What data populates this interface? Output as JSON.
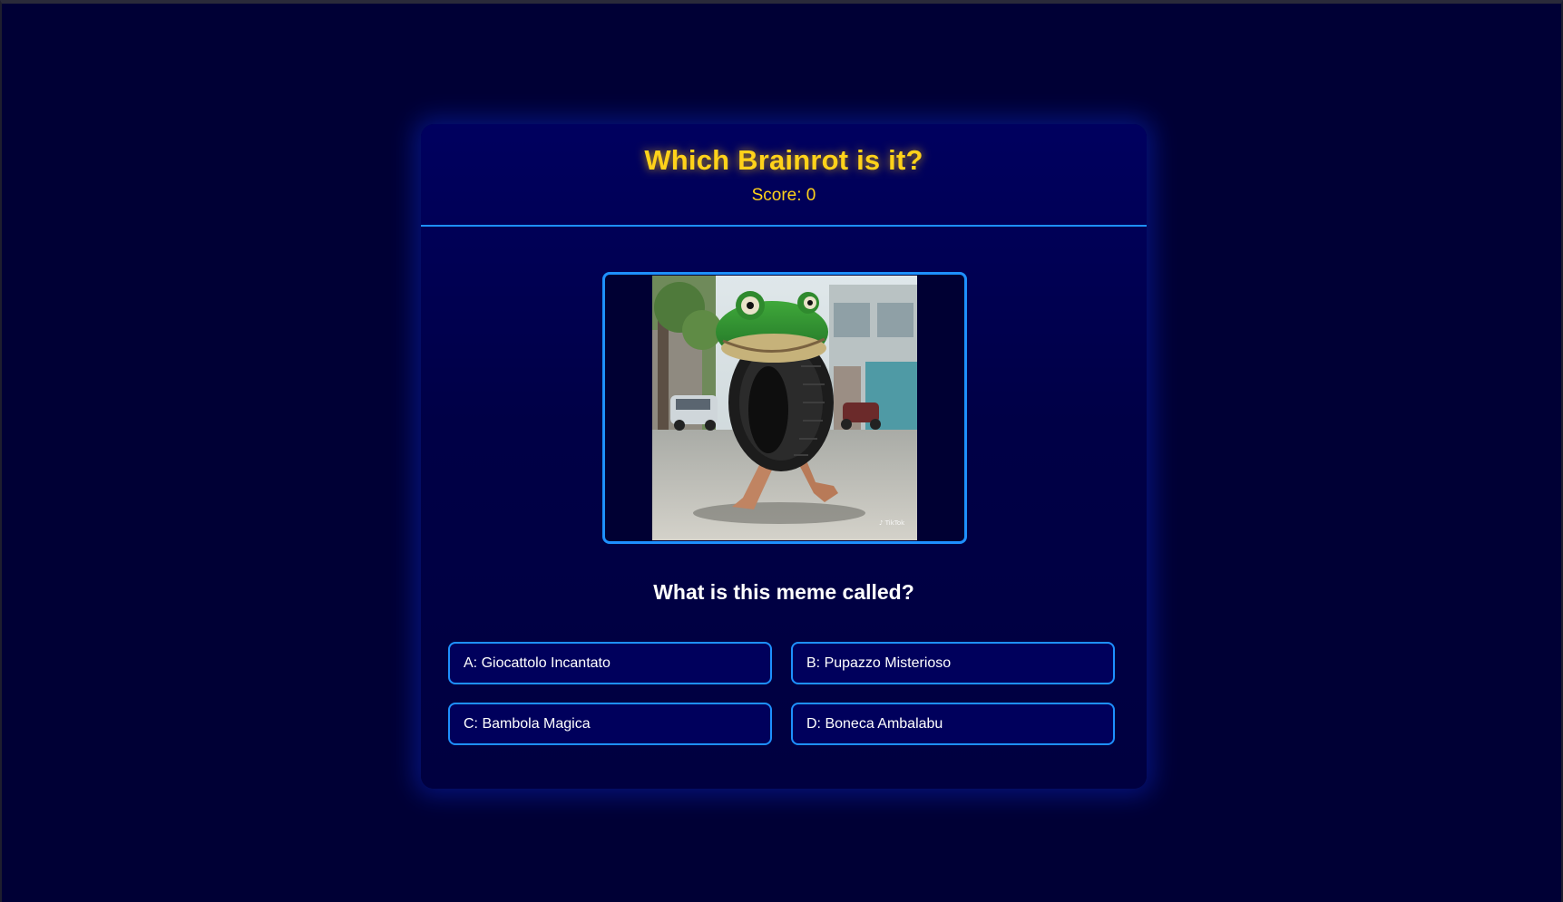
{
  "quiz": {
    "title": "Which Brainrot is it?",
    "score_text": "Score: 0",
    "question": "What is this meme called?",
    "image_icon": "frog-head-tire-meme-image",
    "options": [
      {
        "letter": "A",
        "label": "A: Giocattolo Incantato"
      },
      {
        "letter": "B",
        "label": "B: Pupazzo Misterioso"
      },
      {
        "letter": "C",
        "label": "C: Bambola Magica"
      },
      {
        "letter": "D",
        "label": "D: Boneca Ambalabu"
      }
    ]
  },
  "colors": {
    "page_background": "#000035",
    "card_background": "#00005f",
    "accent_border": "#1e90ff",
    "title_yellow": "#ffd21a",
    "option_background": "#00005c"
  }
}
